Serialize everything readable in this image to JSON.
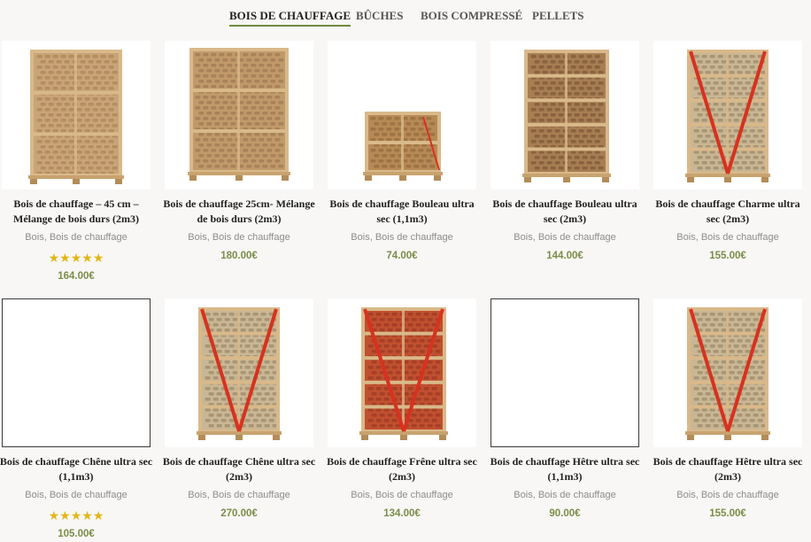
{
  "tabs": [
    {
      "label": "BOIS DE CHAUFFAGE",
      "active": true
    },
    {
      "label": "BÛCHES",
      "active": false
    },
    {
      "label": "BOIS COMPRESSÉ",
      "active": false
    },
    {
      "label": "PELLETS",
      "active": false
    }
  ],
  "categories": {
    "cat1": "Bois",
    "sep": ", ",
    "cat2": "Bois de chauffage"
  },
  "products": [
    {
      "title": "Bois de chauffage – 45 cm – Mélange de bois durs (2m3)",
      "price": "164.00€",
      "rating": 5,
      "stars": "★★★★★",
      "image": "crate-natural-tall"
    },
    {
      "title": "Bois de chauffage 25cm- Mélange de bois durs (2m3)",
      "price": "180.00€",
      "rating": null,
      "stars": "",
      "image": "crate-natural-wide"
    },
    {
      "title": "Bois de chauffage Bouleau ultra sec (1,1m3)",
      "price": "74.00€",
      "rating": null,
      "stars": "",
      "image": "crate-small"
    },
    {
      "title": "Bois de chauffage Bouleau ultra sec (2m3)",
      "price": "144.00€",
      "rating": null,
      "stars": "",
      "image": "crate-red-strap"
    },
    {
      "title": "Bois de chauffage Charme ultra sec (2m3)",
      "price": "155.00€",
      "rating": null,
      "stars": "",
      "image": "crate-red-strap-light"
    },
    {
      "title": "Bois de chauffage Chêne ultra sec (1,1m3)",
      "price": "105.00€",
      "rating": 5,
      "stars": "★★★★★",
      "image": "empty"
    },
    {
      "title": "Bois de chauffage Chêne ultra sec (2m3)",
      "price": "270.00€",
      "rating": null,
      "stars": "",
      "image": "crate-red-strap-light"
    },
    {
      "title": "Bois de chauffage Frêne ultra sec (2m3)",
      "price": "134.00€",
      "rating": null,
      "stars": "",
      "image": "crate-red-net"
    },
    {
      "title": "Bois de chauffage Hêtre ultra sec (1,1m3)",
      "price": "90.00€",
      "rating": null,
      "stars": "",
      "image": "empty"
    },
    {
      "title": "Bois de chauffage Hêtre ultra sec (2m3)",
      "price": "155.00€",
      "rating": null,
      "stars": "",
      "image": "crate-red-strap-light"
    }
  ],
  "colors": {
    "accent": "#6e8a3c",
    "price": "#7b8c4a",
    "star": "#e2b618",
    "strap": "#d8311f"
  }
}
